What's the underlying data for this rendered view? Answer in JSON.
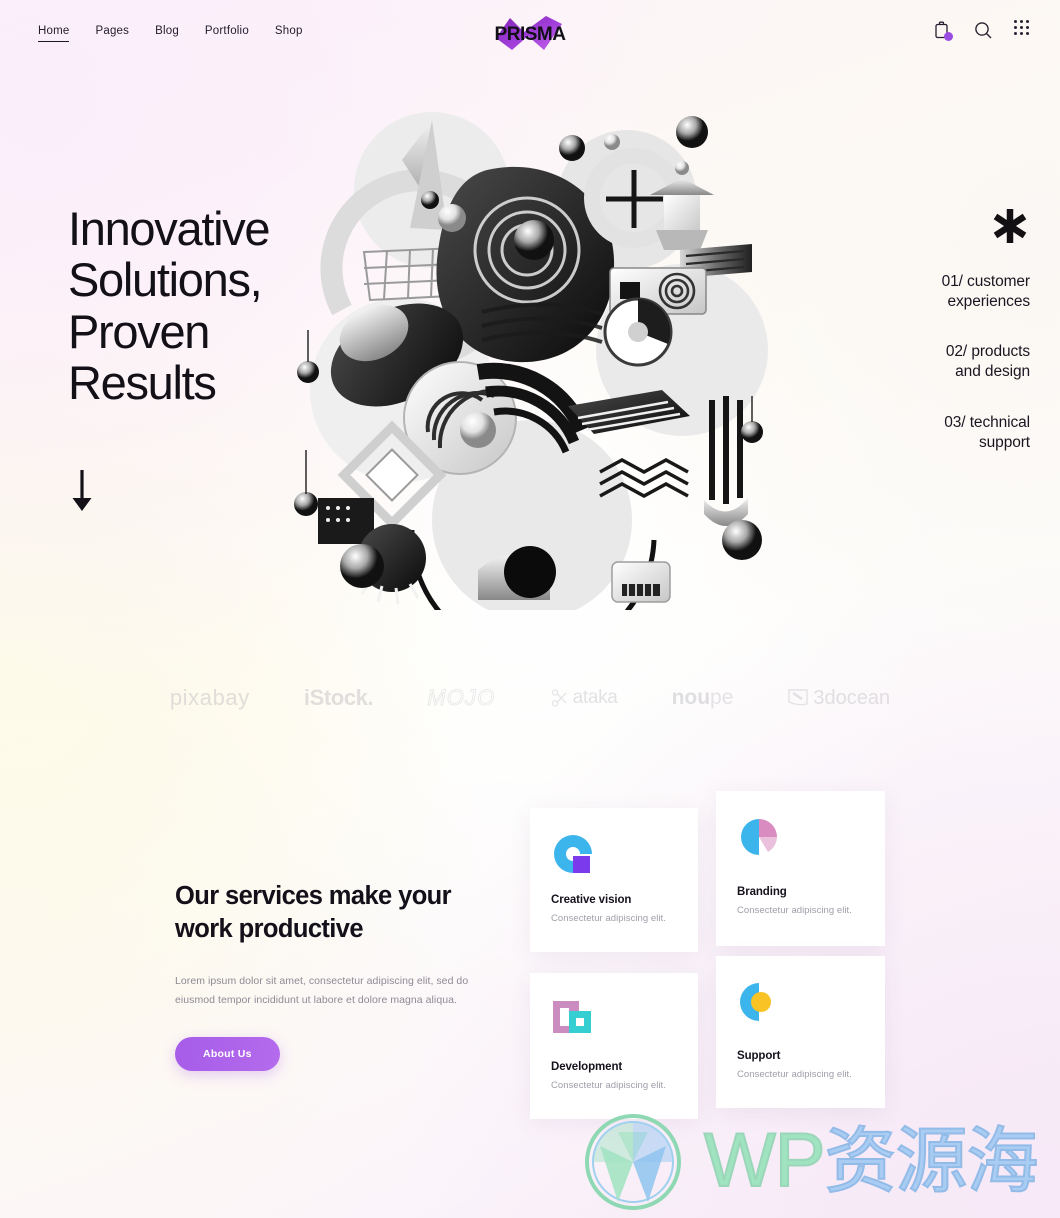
{
  "header": {
    "nav": [
      {
        "label": "Home",
        "active": true
      },
      {
        "label": "Pages",
        "active": false
      },
      {
        "label": "Blog",
        "active": false
      },
      {
        "label": "Portfolio",
        "active": false
      },
      {
        "label": "Shop",
        "active": false
      }
    ],
    "logo_text": "PRISMA",
    "icons": [
      {
        "name": "cart-icon",
        "glyph": "cart",
        "badge": true
      },
      {
        "name": "search-icon",
        "glyph": "search",
        "badge": false
      },
      {
        "name": "grid-menu-icon",
        "glyph": "grid",
        "badge": false
      }
    ]
  },
  "hero": {
    "title": "Innovative\nSolutions,\nProven\nResults",
    "scroll_hint": "scroll-down-arrow",
    "artwork_alt": "abstract monochrome 3d collage"
  },
  "features": {
    "marker": "*",
    "items": [
      {
        "label": "01/ customer\nexperiences"
      },
      {
        "label": "02/ products\nand design"
      },
      {
        "label": "03/ technical\nsupport"
      }
    ]
  },
  "brands": [
    {
      "name": "pixabay",
      "label": "pixabay"
    },
    {
      "name": "istock",
      "label": "iStock."
    },
    {
      "name": "mojo",
      "label": "MOJO"
    },
    {
      "name": "xataka",
      "label": "ataka"
    },
    {
      "name": "noupe",
      "label_bold": "nou",
      "label_light": "pe"
    },
    {
      "name": "3docean",
      "label": "3docean"
    }
  ],
  "services": {
    "title": "Our services make your work productive",
    "description": "Lorem ipsum dolor sit amet, consectetur adipiscing elit, sed do eiusmod tempor incididunt ut labore et dolore magna aliqua.",
    "button_label": "About Us",
    "cards": [
      {
        "name": "creative-vision",
        "title": "Creative vision",
        "subtitle": "Consectetur adipiscing elit.",
        "icon": "blue-arc-purple-square"
      },
      {
        "name": "branding",
        "title": "Branding",
        "subtitle": "Consectetur adipiscing elit.",
        "icon": "pink-semicircle-blue-quarter"
      },
      {
        "name": "development",
        "title": "Development",
        "subtitle": "Consectetur adipiscing elit.",
        "icon": "mauve-square-teal-square"
      },
      {
        "name": "support",
        "title": "Support",
        "subtitle": "Consectetur adipiscing elit.",
        "icon": "blue-halfcircle-yellow-dot"
      }
    ]
  },
  "watermark": {
    "wp": "WP",
    "cn": "资源海"
  },
  "colors": {
    "accent_purple": "#a65ce8",
    "badge_purple": "#9b4de0",
    "icon_blue": "#3cb4ec",
    "icon_pink": "#d98cc0",
    "icon_teal": "#35cfd1",
    "icon_yellow": "#f9c326",
    "text_dark": "#141018",
    "text_muted": "#8d8a95"
  }
}
